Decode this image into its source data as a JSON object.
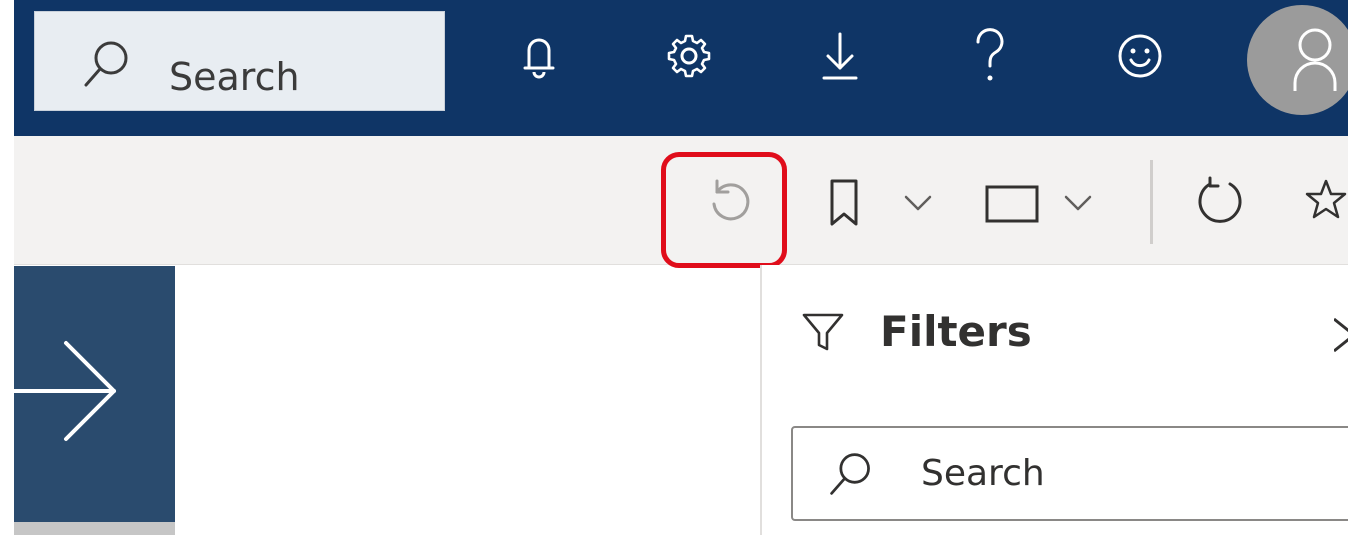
{
  "header": {
    "search_placeholder": "Search",
    "icons": [
      "bell-icon",
      "gear-icon",
      "download-icon",
      "help-icon",
      "smiley-icon",
      "person-icon"
    ]
  },
  "actionbar": {
    "icons": [
      "undo-icon",
      "bookmark-icon",
      "chevron-down-icon",
      "window-icon",
      "chevron-down-icon",
      "refresh-icon",
      "star-icon"
    ],
    "highlight_color": "#e00d1b"
  },
  "filters": {
    "title": "Filters",
    "search_placeholder": "Search"
  },
  "colors": {
    "nav_bg": "#0f3566",
    "panel_bg": "#2a4b6e",
    "toolbar_bg": "#f3f2f1"
  }
}
